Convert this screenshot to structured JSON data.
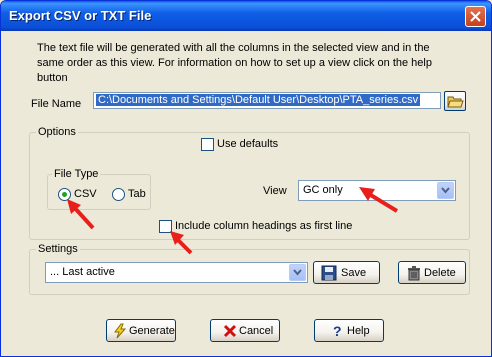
{
  "window": {
    "title": "Export CSV or TXT File"
  },
  "description": "The text file will be generated with all the columns in the selected view and in the same order as this view. For information on how to set up a view click on the help button",
  "file_name": {
    "label": "File Name",
    "value": "C:\\Documents and Settings\\Default User\\Desktop\\PTA_series.csv"
  },
  "options": {
    "label": "Options",
    "use_defaults_label": "Use defaults",
    "file_type": {
      "label": "File Type",
      "csv_label": "CSV",
      "tab_label": "Tab",
      "selected": "CSV"
    },
    "view_label": "View",
    "view_value": "GC only",
    "include_headings_label": "Include column headings as first line"
  },
  "settings": {
    "label": "Settings",
    "value": "... Last active",
    "save_label": "Save",
    "delete_label": "Delete"
  },
  "buttons": {
    "generate": "Generate",
    "cancel": "Cancel",
    "help": "Help"
  },
  "colors": {
    "titlebar": "#0B4FD8",
    "annotation_arrow": "#E8201C",
    "selection": "#316AC5"
  }
}
